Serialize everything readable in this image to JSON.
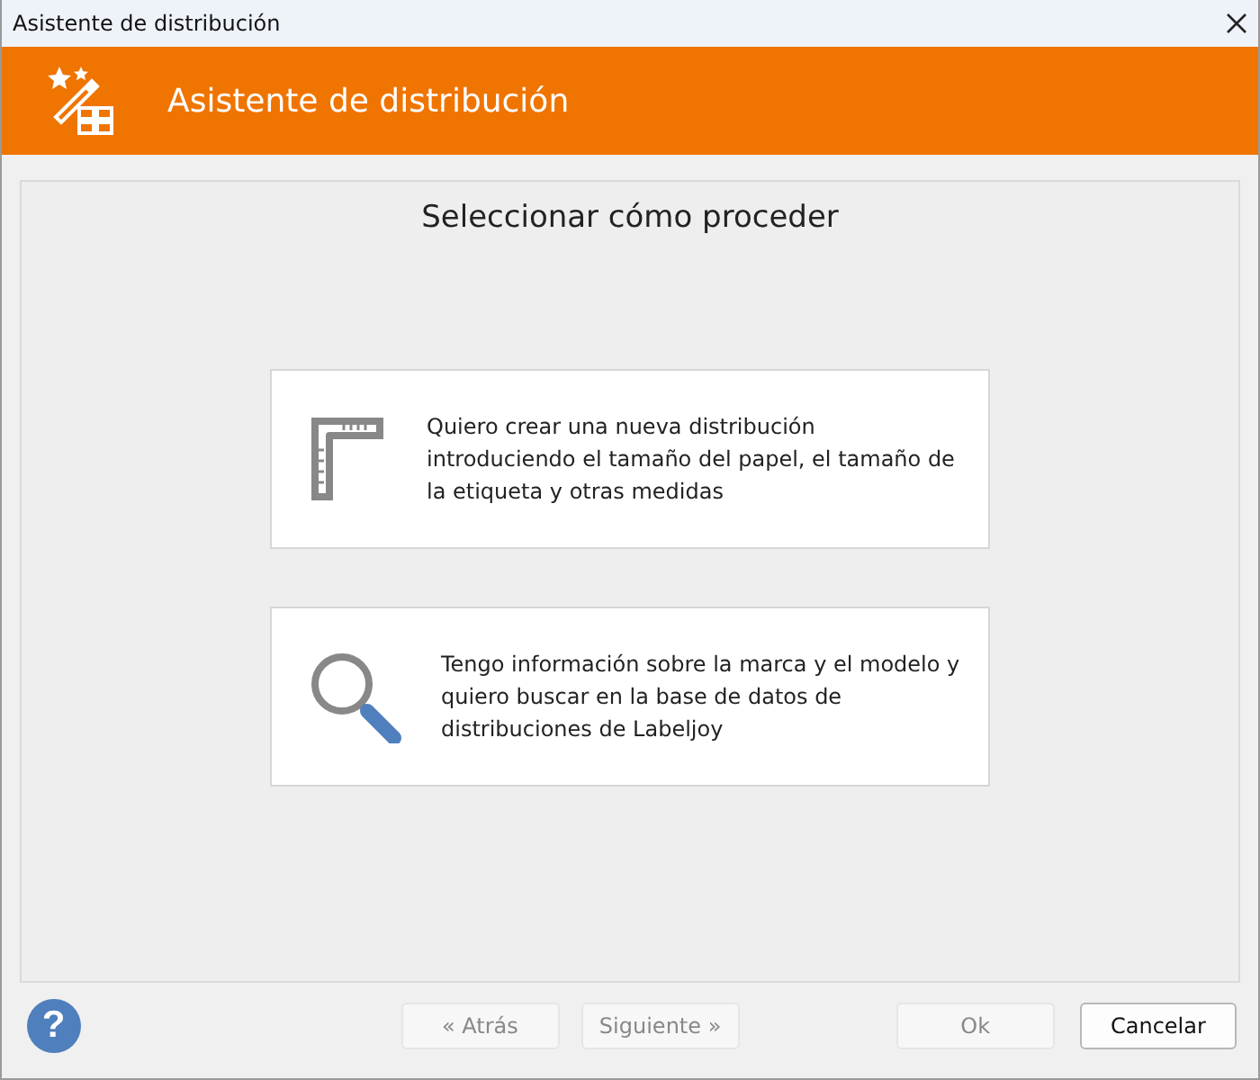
{
  "window": {
    "title": "Asistente de distribución"
  },
  "header": {
    "title": "Asistente de distribución"
  },
  "heading": "Seleccionar cómo proceder",
  "options": [
    {
      "kind": "ruler",
      "text": "Quiero crear una nueva distribución introduciendo el tamaño del papel, el tamaño de la etiqueta y otras medidas"
    },
    {
      "kind": "search",
      "text": "Tengo información sobre la marca y el modelo y quiero buscar en la base de datos de distribuciones de Labeljoy"
    }
  ],
  "help": "?",
  "buttons": [
    {
      "label": "« Atrás",
      "disabled": true
    },
    {
      "label": "Siguiente »",
      "disabled": true
    },
    {
      "label": "Ok",
      "disabled": true
    },
    {
      "label": "Cancelar",
      "disabled": false
    }
  ]
}
